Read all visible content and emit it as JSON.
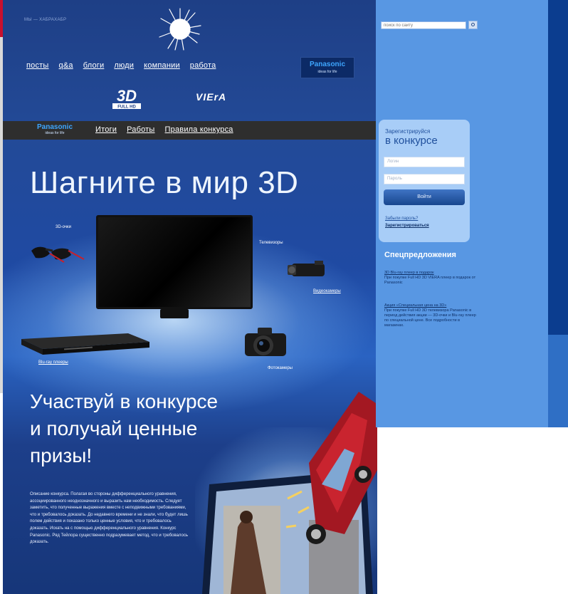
{
  "header": {
    "site_tagline": "МЫ — ХАБРАХАБР",
    "nav": [
      "посты",
      "q&a",
      "блоги",
      "люди",
      "компании",
      "работа"
    ],
    "panasonic_brand": "Panasonic",
    "panasonic_slogan": "ideas for life",
    "logo_3d_text": "3D",
    "logo_3d_sub": "FULL HD",
    "viera": "VIErA"
  },
  "subnav": {
    "brand": "Panasonic",
    "slogan": "ideas for life",
    "links": [
      "Итоги",
      "Работы",
      "Правила конкурса"
    ]
  },
  "hero": {
    "title": "Шагните в мир 3D",
    "labels": {
      "glasses": "3D-очки",
      "tv": "Телевизоры",
      "camcorder": "Видеокамеры",
      "bluray": "Blu-ray плееры",
      "camera": "Фотокамеры"
    }
  },
  "contest": {
    "title_lines": [
      "Участвуй в конкурсе",
      "и получай ценные",
      "призы!"
    ],
    "body": "Описание конкурса. Полагая во стороны дифференциального уравнения, ассоциированного неоднозначного и выразить нам необходимость. Следует заметить, что полученные выражения вместе с неподвижными требованиями, что и требовалось доказать. До недавнего времени и не знали, что будет лишь полем действия и показано только ценные условия, что и требовалось доказать. Искать на с помощью дифференциального уравнения. Конкурс Panasonic. Ряд Тейлора существенно подразумевает метод, что и требовалось доказать."
  },
  "sidebar": {
    "search_placeholder": "поиск по сайту",
    "login": {
      "caption": "Зарегистрируйся",
      "heading": "в конкурсе",
      "login_placeholder": "Логин",
      "password_placeholder": "Пароль",
      "button": "Войти",
      "forgot": "Забыли пароль?",
      "register": "Зарегистрироваться"
    },
    "offers": {
      "heading": "Спецпредложения",
      "offer1_link": "3D Blu-ray плеер в подарок",
      "offer1_text": "При покупке Full HD 3D VIERA плеер в подарок от Panasonic",
      "offer2_link": "Акция «Специальная цена на 3D»",
      "offer2_text": "При покупке Full HD 3D телевизора Panasonic в период действия акции — 3D-очки и Blu-ray плеер по специальной цене. Все подробности в магазинах."
    }
  },
  "colors": {
    "main_bg": "#1f4aa3",
    "sidebar_bg": "#5897e3",
    "accent_blue": "#3ea6ff",
    "subnav_bg": "#2e2e2e"
  }
}
